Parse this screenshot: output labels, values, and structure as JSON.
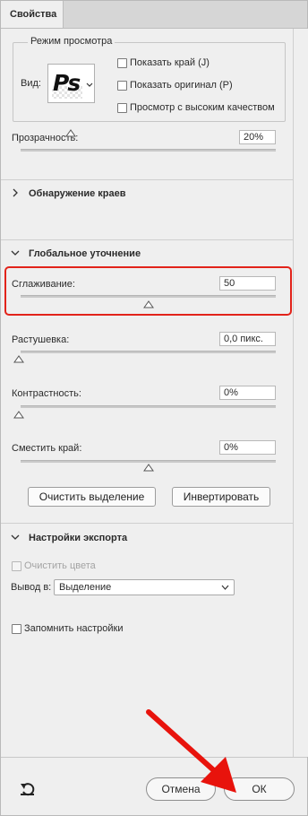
{
  "panel": {
    "tab_title": "Свойства"
  },
  "view_mode": {
    "title": "Режим просмотра",
    "view_label": "Вид:",
    "thumbnail_text": "Ps",
    "options": [
      {
        "label": "Показать край (J)",
        "checked": false
      },
      {
        "label": "Показать оригинал (P)",
        "checked": false
      },
      {
        "label": "Просмотр с высоким качеством",
        "checked": false
      }
    ]
  },
  "opacity": {
    "label": "Прозрачность:",
    "value": "20%",
    "level": 0.2
  },
  "edge_detection": {
    "title": "Обнаружение краев",
    "expanded": false
  },
  "global_refinement": {
    "title": "Глобальное уточнение",
    "expanded": true,
    "smooth": {
      "label": "Сглаживание:",
      "value": "50",
      "level": 0.5
    },
    "feather": {
      "label": "Растушевка:",
      "value": "0,0 пикс.",
      "level": 0
    },
    "contrast": {
      "label": "Контрастность:",
      "value": "0%",
      "level": 0
    },
    "shift_edge": {
      "label": "Сместить край:",
      "value": "0%",
      "level": 0.5
    },
    "clear_selection_button": "Очистить выделение",
    "invert_button": "Инвертировать"
  },
  "export_settings": {
    "title": "Настройки экспорта",
    "expanded": true,
    "decontaminate_label": "Очистить цвета",
    "output_label": "Вывод в:",
    "output_value": "Выделение",
    "remember_label": "Запомнить настройки"
  },
  "footer": {
    "cancel_label": "Отмена",
    "ok_label": "ОК"
  },
  "colors": {
    "highlight_box": "#e2231a",
    "arrow": "#e8130c"
  }
}
